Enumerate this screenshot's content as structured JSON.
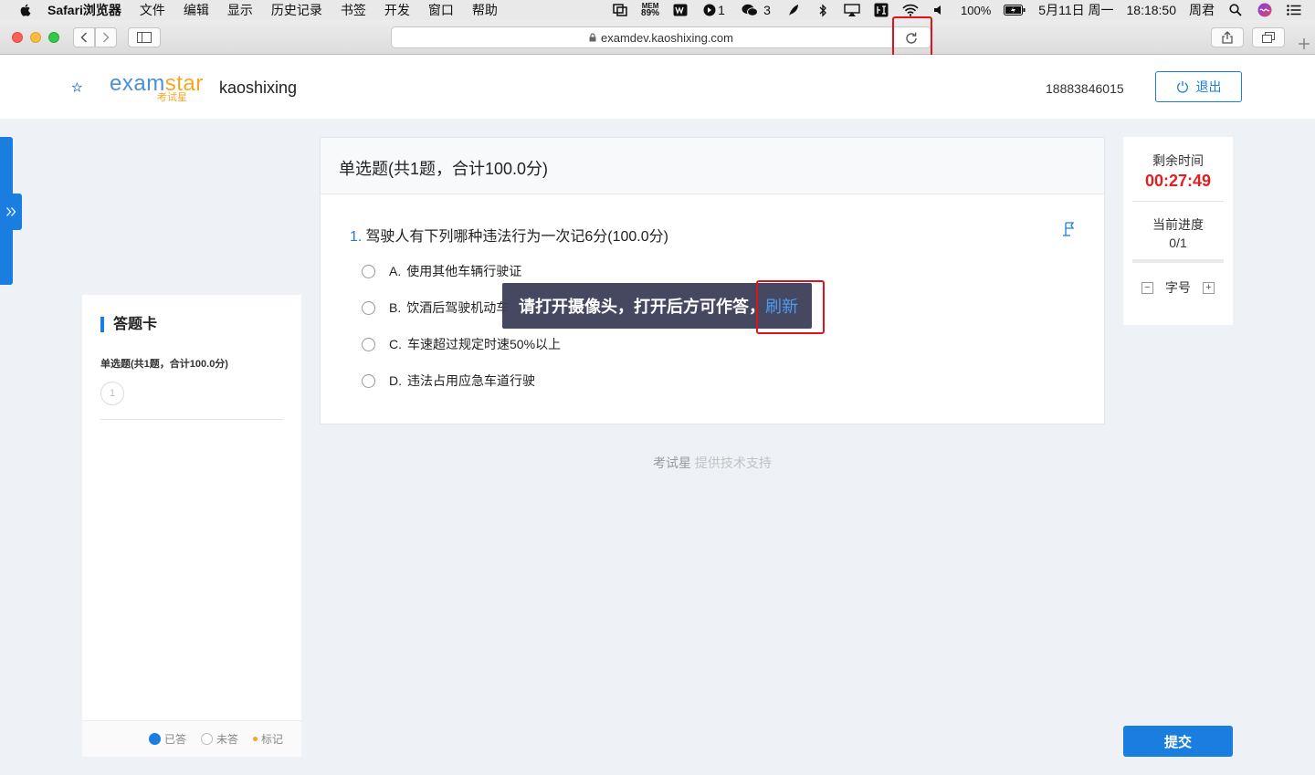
{
  "menubar": {
    "app_name": "Safari浏览器",
    "items": [
      "文件",
      "编辑",
      "显示",
      "历史记录",
      "书签",
      "开发",
      "窗口",
      "帮助"
    ],
    "mem_label": "MEM",
    "mem_value": "89%",
    "badge_1": "1",
    "wechat_count": "3",
    "battery": "100%",
    "date": "5月11日 周一",
    "time": "18:18:50",
    "user": "周君"
  },
  "browser": {
    "url": "examdev.kaoshixing.com"
  },
  "header": {
    "logo_text_a": "exam",
    "logo_text_b": "star",
    "logo_sub": "考试星",
    "org_name": "kaoshixing",
    "phone": "18883846015",
    "logout_label": "退出"
  },
  "answer_card": {
    "title": "答题卡",
    "section": "单选题(共1题，合计100.0分)",
    "question_numbers": [
      "1"
    ],
    "legend": {
      "answered": "已答",
      "unanswered": "未答",
      "marked": "标记"
    }
  },
  "question_panel": {
    "section_title": "单选题(共1题，合计100.0分)",
    "question_number": "1.",
    "question_text": "驾驶人有下列哪种违法行为一次记6分(100.0分)",
    "options": [
      {
        "letter": "A.",
        "text": "使用其他车辆行驶证"
      },
      {
        "letter": "B.",
        "text": "饮酒后驾驶机动车"
      },
      {
        "letter": "C.",
        "text": "车速超过规定时速50%以上"
      },
      {
        "letter": "D.",
        "text": "违法占用应急车道行驶"
      }
    ]
  },
  "toast": {
    "message": "请打开摄像头，打开后方可作答，",
    "link": "刷新"
  },
  "footer": {
    "brand": "考试星",
    "support": "提供技术支持"
  },
  "timer": {
    "remaining_label": "剩余时间",
    "remaining_value": "00:27:49",
    "progress_label": "当前进度",
    "progress_value": "0/1",
    "font_size_label": "字号",
    "minus": "−",
    "plus": "+"
  },
  "submit_label": "提交",
  "colors": {
    "accent": "#1a7de0",
    "timer_red": "#e02020",
    "highlight_red": "#e0131b",
    "toast_bg": "#3c3e58"
  }
}
